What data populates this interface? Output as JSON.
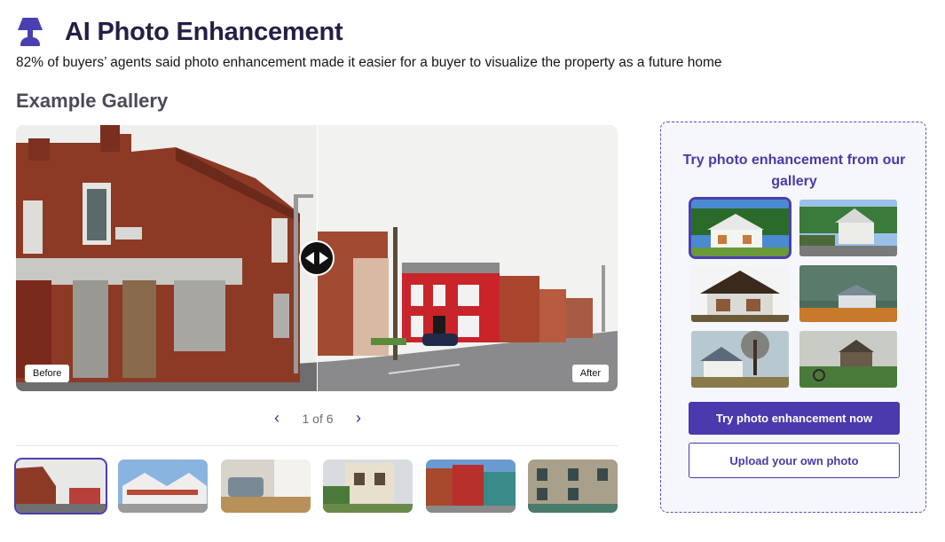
{
  "header": {
    "title": "AI Photo Enhancement",
    "icon": "lamp-icon",
    "subtitle": "82% of buyers’ agents said photo enhancement made it easier for a buyer to visualize the property as a future home"
  },
  "gallery": {
    "heading": "Example Gallery",
    "before_label": "Before",
    "after_label": "After",
    "pager_text": "1 of 6",
    "prev_icon": "chevron-left-icon",
    "next_icon": "chevron-right-icon",
    "selected_index": 0,
    "thumbnail_count": 6
  },
  "panel": {
    "title": "Try photo enhancement from our gallery",
    "selected_index": 0,
    "image_count": 6,
    "primary_button": "Try photo enhancement now",
    "secondary_button": "Upload your own photo"
  },
  "colors": {
    "accent": "#4a3fb0",
    "panel_bg": "#f6f6fd",
    "title_text": "#231f45"
  }
}
